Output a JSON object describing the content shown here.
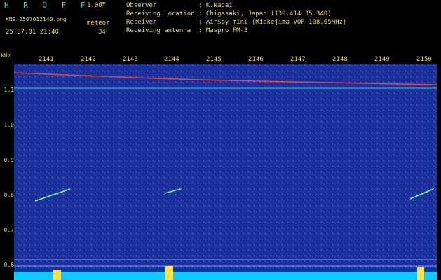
{
  "header": {
    "title": "H R O F F T",
    "version": "1.00f",
    "filename": "KN9_2507012140.png",
    "meteor_label": "meteor",
    "meteor_count": "34",
    "timestamp": "25.07.01 21:40",
    "observer_label": "Observer",
    "observer_value": ": K.Nagai",
    "location_label": "Receiving Location",
    "location_value": ": Chigasaki, Japan (139.414 35.340)",
    "receiver_label": "Receiver",
    "receiver_value": ": AirSpy mini (Miakejima VOR 108.65MHz)",
    "antenna_label": "Receiving antenna",
    "antenna_value": ": Maspro FM-3"
  },
  "axis": {
    "unit": "kHz",
    "time_ticks": [
      "2141",
      "2142",
      "2143",
      "2144",
      "2145",
      "2146",
      "2147",
      "2148",
      "2149",
      "2150"
    ],
    "freq_ticks": [
      "1.1",
      "1.0",
      "0.9",
      "0.8",
      "0.7",
      "0.6"
    ]
  },
  "colors": {
    "background": "#1b2f9a",
    "accent_text": "#e8d25a",
    "title_text": "#4fd0c8",
    "carrier": "#d94a4a"
  }
}
